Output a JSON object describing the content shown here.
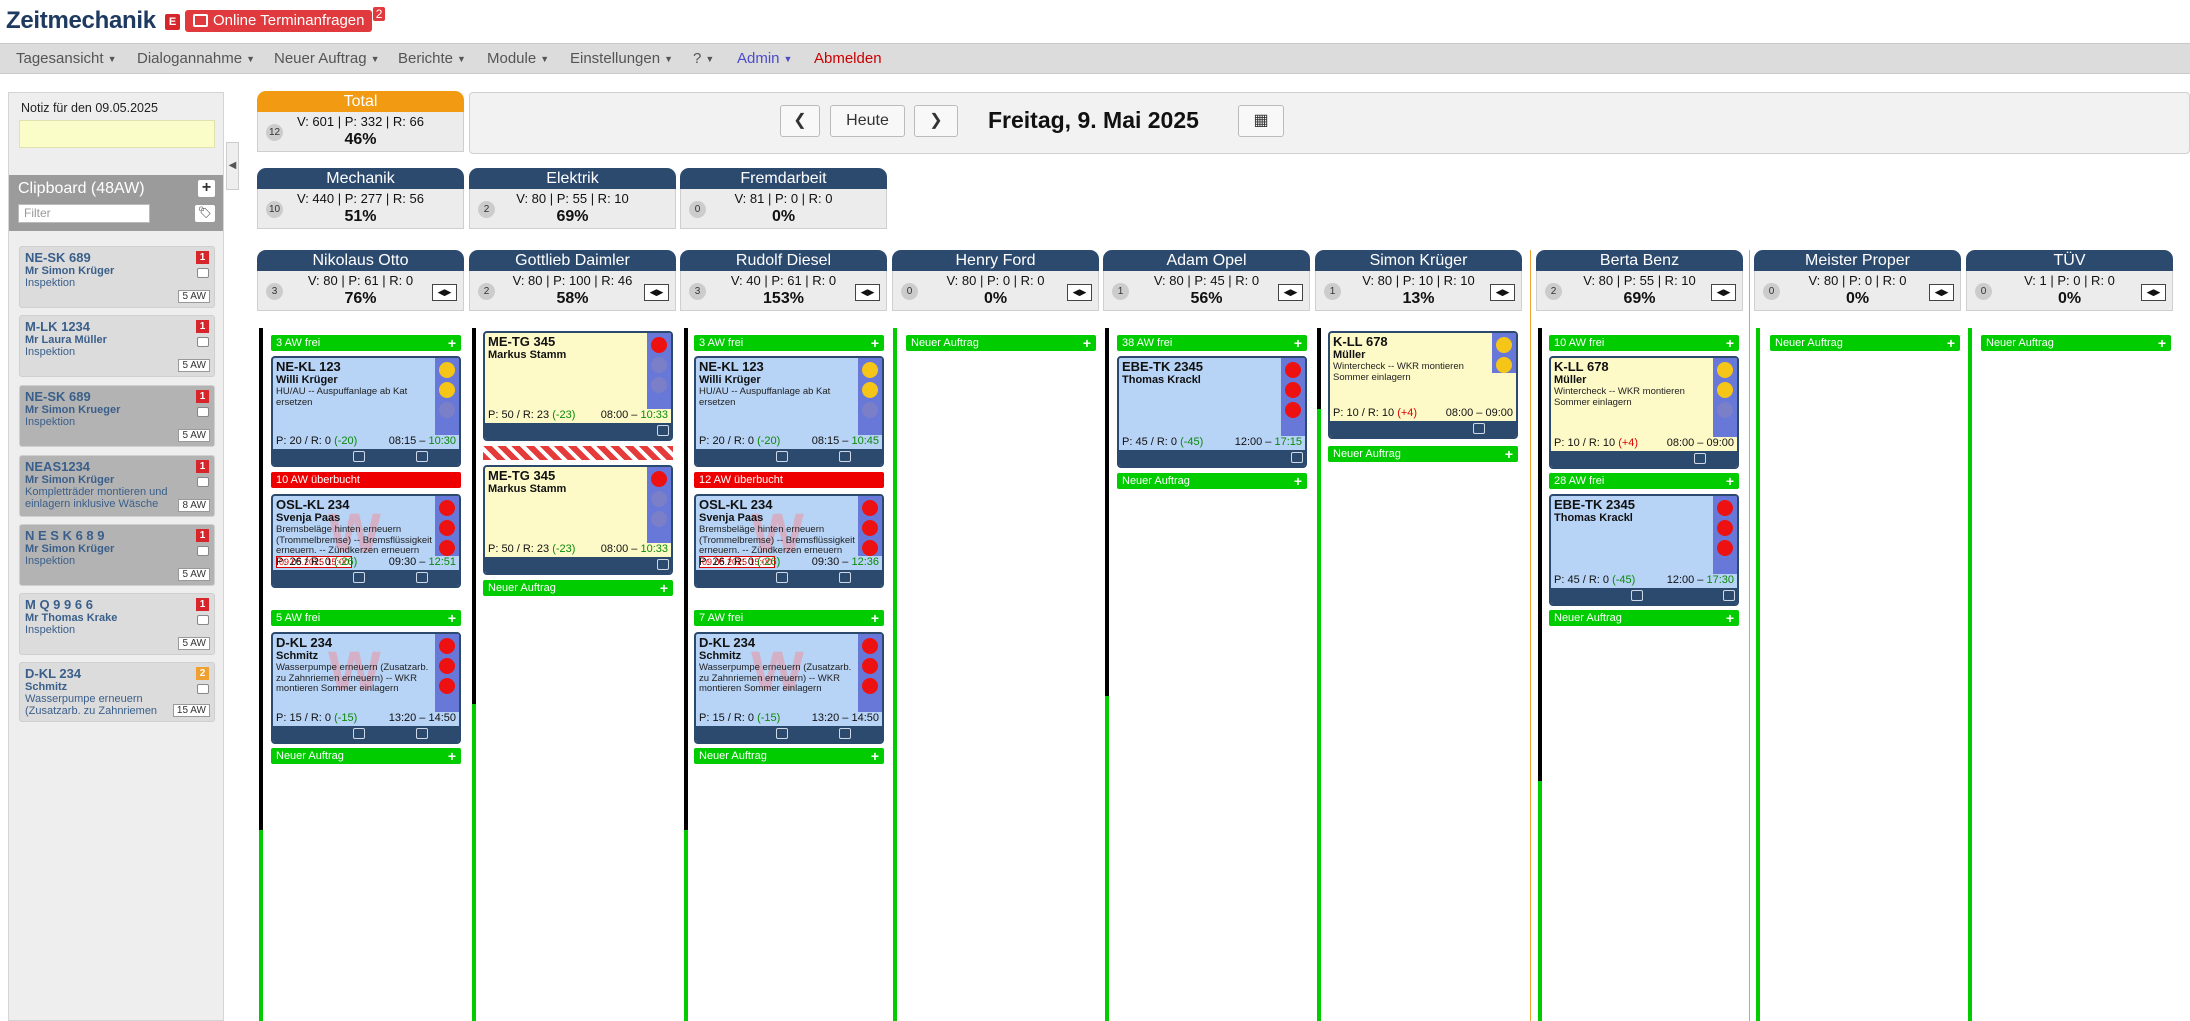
{
  "app": {
    "title": "Zeitmechanik",
    "e_badge": "E",
    "online_label": "Online Terminanfragen",
    "online_count": "2"
  },
  "menu": [
    {
      "label": "Tagesansicht",
      "caret": true,
      "color": "#555555"
    },
    {
      "label": "Dialogannahme",
      "caret": true,
      "color": "#555555"
    },
    {
      "label": "Neuer Auftrag",
      "caret": true,
      "color": "#555555"
    },
    {
      "label": "Berichte",
      "caret": true,
      "color": "#555555"
    },
    {
      "label": "Module",
      "caret": true,
      "color": "#555555"
    },
    {
      "label": "Einstellungen",
      "caret": true,
      "color": "#555555"
    },
    {
      "label": "?",
      "caret": true,
      "color": "#555555"
    },
    {
      "label": "Admin",
      "caret": true,
      "color": "#4b4bcc"
    },
    {
      "label": "Abmelden",
      "caret": false,
      "color": "#cc0000"
    }
  ],
  "notiz": {
    "label": "Notiz für den 09.05.2025",
    "value": ""
  },
  "clipboard": {
    "title": "Clipboard (48AW)",
    "add_icon": "+",
    "filter_placeholder": "Filter",
    "items": [
      {
        "plate": "NE-SK 689",
        "customer": "Mr Simon Krüger",
        "desc": "Inspektion",
        "badge": "1",
        "badge_color": "#d6262b",
        "aw": "5 AW",
        "bg": "#dcdcdc"
      },
      {
        "plate": "M-LK 1234",
        "customer": "Mr Laura Müller",
        "desc": "Inspektion",
        "badge": "1",
        "badge_color": "#d6262b",
        "aw": "5 AW",
        "bg": "#dcdcdc"
      },
      {
        "plate": "NE-SK 689",
        "customer": "Mr Simon Krueger",
        "desc": "Inspektion",
        "badge": "1",
        "badge_color": "#d6262b",
        "aw": "5 AW",
        "bg": "#b3b3b3"
      },
      {
        "plate": "NEAS1234",
        "customer": "Mr Simon Krüger",
        "desc": "Kompletträder montieren und einlagern inklusive Wäsche",
        "badge": "1",
        "badge_color": "#d6262b",
        "aw": "8 AW",
        "bg": "#b3b3b3"
      },
      {
        "plate": "N E S K 6 8 9",
        "customer": "Mr Simon Krüger",
        "desc": "Inspektion",
        "badge": "1",
        "badge_color": "#d6262b",
        "aw": "5 AW",
        "bg": "#b3b3b3"
      },
      {
        "plate": "M Q 9 9 6 6",
        "customer": "Mr Thomas Krake",
        "desc": "Inspektion",
        "badge": "1",
        "badge_color": "#d6262b",
        "aw": "5 AW",
        "bg": "#dcdcdc"
      },
      {
        "plate": "D-KL 234",
        "customer": "Schmitz",
        "desc": "Wasserpumpe erneuern (Zusatzarb. zu Zahnriemen erneuern) -- WK...",
        "badge": "2",
        "badge_color": "#f0a030",
        "aw": "15 AW",
        "bg": "#dcdcdc"
      }
    ]
  },
  "total": {
    "title": "Total",
    "count": "12",
    "vpr": "V: 601 | P: 332 | R: 66",
    "pct": "46%"
  },
  "groups": [
    {
      "title": "Mechanik",
      "count": "10",
      "vpr": "V: 440 | P: 277 | R: 56",
      "pct": "51%"
    },
    {
      "title": "Elektrik",
      "count": "2",
      "vpr": "V: 80 | P: 55 | R: 10",
      "pct": "69%"
    },
    {
      "title": "Fremdarbeit",
      "count": "0",
      "vpr": "V: 81 | P: 0 | R: 0",
      "pct": "0%"
    }
  ],
  "datenav": {
    "prev": "❮",
    "today": "Heute",
    "next": "❯",
    "date": "Freitag, 9. Mai 2025",
    "cal_icon": "▦"
  },
  "workers": [
    {
      "name": "Nikolaus Otto",
      "count": "3",
      "vpr": "V: 80 | P: 61 | R: 0",
      "pct": "76%"
    },
    {
      "name": "Gottlieb Daimler",
      "count": "2",
      "vpr": "V: 80 | P: 100 | R: 46",
      "pct": "58%"
    },
    {
      "name": "Rudolf Diesel",
      "count": "3",
      "vpr": "V: 40 | P: 61 | R: 0",
      "pct": "153%"
    },
    {
      "name": "Henry Ford",
      "count": "0",
      "vpr": "V: 80 | P: 0 | R: 0",
      "pct": "0%"
    },
    {
      "name": "Adam Opel",
      "count": "1",
      "vpr": "V: 80 | P: 45 | R: 0",
      "pct": "56%"
    },
    {
      "name": "Simon Krüger",
      "count": "1",
      "vpr": "V: 80 | P: 10 | R: 10",
      "pct": "13%"
    },
    {
      "name": "Berta Benz",
      "count": "2",
      "vpr": "V: 80 | P: 55 | R: 10",
      "pct": "69%"
    },
    {
      "name": "Meister Proper",
      "count": "0",
      "vpr": "V: 80 | P: 0 | R: 0",
      "pct": "0%"
    },
    {
      "name": "TÜV",
      "count": "0",
      "vpr": "V: 1 | P: 0 | R: 0",
      "pct": "0%"
    }
  ],
  "arrows_glyph": "◀▶",
  "bars": {
    "otto_free1": "3 AW frei",
    "otto_over": "10 AW überbucht",
    "otto_free2": "5 AW frei",
    "otto_new": "Neuer Auftrag",
    "daimler_new": "Neuer Auftrag",
    "diesel_free1": "3 AW frei",
    "diesel_over": "12 AW überbucht",
    "diesel_free2": "7 AW frei",
    "diesel_new": "Neuer Auftrag",
    "ford_new": "Neuer Auftrag",
    "opel_free": "38 AW frei",
    "opel_new": "Neuer Auftrag",
    "krueger_new": "Neuer Auftrag",
    "benz_free1": "10 AW frei",
    "benz_free2": "28 AW frei",
    "benz_new": "Neuer Auftrag",
    "proper_new": "Neuer Auftrag",
    "tuev_new": "Neuer Auftrag",
    "plus": "+"
  },
  "jobs": {
    "otto1": {
      "plate": "NE-KL 123",
      "cust": "Willi Krüger",
      "desc": "HU/AU -- Auspuffanlage ab Kat ersetzen",
      "pr_a": "P: 20 / R: 0 ",
      "pr_b": "(-20)",
      "tm_a": "08:15 – ",
      "tm_b": "10:30"
    },
    "otto2": {
      "plate": "OSL-KL 234",
      "cust": "Svenja Paas",
      "desc": "Bremsbeläge hinten erneuern (Trommelbremse) -- Bremsflüssigkeit erneuern. -- Zündkerzen erneuern",
      "date_tag": "09.05.2025 15:00",
      "pr_a": "P: 26 / R: 0 ",
      "pr_b": "(-26)",
      "tm_a": "09:30 – ",
      "tm_b": "12:51",
      "watermark": "W"
    },
    "otto3": {
      "plate": "D-KL 234",
      "cust": "Schmitz",
      "desc": "Wasserpumpe erneuern (Zusatzarb. zu Zahnriemen erneuern) -- WKR montieren Sommer einlagern",
      "pr_a": "P: 15 / R: 0 ",
      "pr_b": "(-15)",
      "tm_a": "13:20 – 14:50",
      "tm_b": "",
      "watermark": "W"
    },
    "daimler1": {
      "plate": "ME-TG 345",
      "cust": "Markus Stamm",
      "desc": "",
      "pr_a": "P: 50 / R: 23 ",
      "pr_b": "(-23)",
      "tm_a": "08:00 – ",
      "tm_b": "10:33"
    },
    "daimler2": {
      "plate": "ME-TG 345",
      "cust": "Markus Stamm",
      "desc": "",
      "pr_a": "P: 50 / R: 23 ",
      "pr_b": "(-23)",
      "tm_a": "08:00 – ",
      "tm_b": "10:33"
    },
    "diesel1": {
      "plate": "NE-KL 123",
      "cust": "Willi Krüger",
      "desc": "HU/AU -- Auspuffanlage ab Kat ersetzen",
      "pr_a": "P: 20 / R: 0 ",
      "pr_b": "(-20)",
      "tm_a": "08:15 – ",
      "tm_b": "10:45"
    },
    "diesel2": {
      "plate": "OSL-KL 234",
      "cust": "Svenja Paas",
      "desc": "Bremsbeläge hinten erneuern (Trommelbremse) -- Bremsflüssigkeit erneuern. -- Zündkerzen erneuern",
      "date_tag": "09.05.2025 15:00",
      "pr_a": "P: 26 / R: 0 ",
      "pr_b": "(-26)",
      "tm_a": "09:30 – ",
      "tm_b": "12:36",
      "watermark": "W"
    },
    "diesel3": {
      "plate": "D-KL 234",
      "cust": "Schmitz",
      "desc": "Wasserpumpe erneuern (Zusatzarb. zu Zahnriemen erneuern) -- WKR montieren Sommer einlagern",
      "pr_a": "P: 15 / R: 0 ",
      "pr_b": "(-15)",
      "tm_a": "13:20 – 14:50",
      "tm_b": "",
      "watermark": "W"
    },
    "opel1": {
      "plate": "EBE-TK 2345",
      "cust": "Thomas Krackl",
      "desc": "",
      "pr_a": "P: 45 / R: 0 ",
      "pr_b": "(-45)",
      "tm_a": "12:00 – ",
      "tm_b": "17:15"
    },
    "krueger1": {
      "plate": "K-LL 678",
      "cust": "Müller",
      "desc": "Wintercheck -- WKR montieren Sommer einlagern",
      "pr_a": "P: 10 / R: 10 ",
      "pr_b": "(+4)",
      "tm_a": "08:00 – 09:00",
      "tm_b": ""
    },
    "benz1": {
      "plate": "K-LL 678",
      "cust": "Müller",
      "desc": "Wintercheck -- WKR montieren Sommer einlagern",
      "pr_a": "P: 10 / R: 10 ",
      "pr_b": "(+4)",
      "tm_a": "08:00 – 09:00",
      "tm_b": ""
    },
    "benz2": {
      "plate": "EBE-TK 2345",
      "cust": "Thomas Krackl",
      "desc": "",
      "pr_a": "P: 45 / R: 0 ",
      "pr_b": "(-45)",
      "tm_a": "12:00 – ",
      "tm_b": "17:30"
    }
  },
  "colors": {
    "blue_card": "#b7d3f5",
    "yellow_card": "#fdfac8",
    "light_red": "#ee1111",
    "light_yellow": "#f5c518",
    "light_green": "#3fae3f",
    "light_off": "#7a7fc8",
    "header_navy": "#2c4a6e",
    "total_orange": "#f29b12",
    "free_green": "#00cc00",
    "over_red": "#ee0000"
  }
}
